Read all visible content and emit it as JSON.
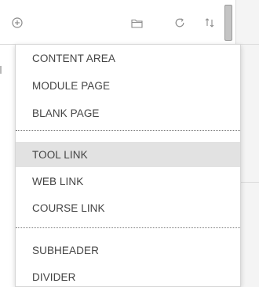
{
  "toolbar": {
    "icons": [
      {
        "name": "add-circle-icon"
      },
      {
        "name": "folder-icon"
      },
      {
        "name": "refresh-icon"
      },
      {
        "name": "sort-icon"
      }
    ]
  },
  "menu": {
    "groups": [
      [
        "CONTENT AREA",
        "MODULE PAGE",
        "BLANK PAGE"
      ],
      [
        "TOOL LINK",
        "WEB LINK",
        "COURSE LINK"
      ],
      [
        "SUBHEADER",
        "DIVIDER"
      ]
    ],
    "highlighted_item": "TOOL LINK",
    "colors": {
      "highlight": "#e2e2e2",
      "text": "#444444",
      "icon": "#8a8a8a"
    }
  }
}
